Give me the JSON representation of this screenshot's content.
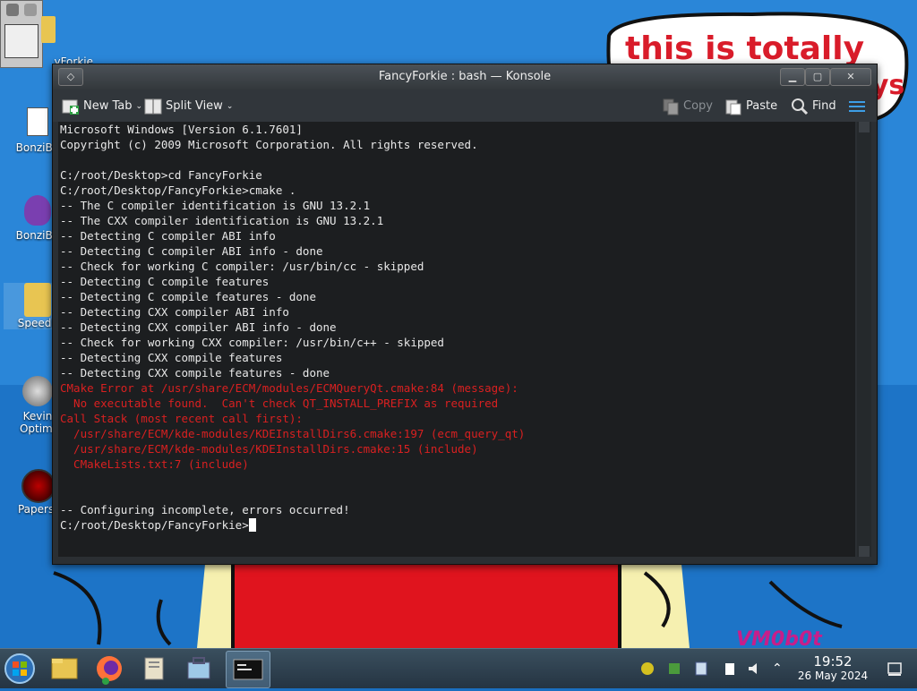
{
  "wallpaper": {
    "text_top": "this is totally",
    "text_top2": "guys",
    "text_bottom": "VM0b0t"
  },
  "desktop_icons": [
    {
      "label": "FancyForkie",
      "display": "yForkie"
    },
    {
      "label": "BonziBuddy",
      "display": "BonziBu"
    },
    {
      "label": "BonziBuddy",
      "display": "BonziBu"
    },
    {
      "label": "SpeedFan",
      "display": "SpeedF"
    },
    {
      "label": "Kevin Optimizer",
      "display": "Kevin"
    },
    {
      "label": "Optimizer",
      "display": "Optimi"
    },
    {
      "label": "Papers, Please",
      "display": "Papers,"
    }
  ],
  "window": {
    "title": "FancyForkie : bash — Konsole",
    "controls": {
      "minimize": "▁",
      "maximize": "▢",
      "close": "✕",
      "menu": "◇"
    }
  },
  "toolbar": {
    "new_tab": "New Tab",
    "split_view": "Split View",
    "copy": "Copy",
    "paste": "Paste",
    "find": "Find"
  },
  "terminal": {
    "lines": [
      {
        "text": "Microsoft Windows [Version 6.1.7601]",
        "type": "normal"
      },
      {
        "text": "Copyright (c) 2009 Microsoft Corporation. All rights reserved.",
        "type": "normal"
      },
      {
        "text": "",
        "type": "normal"
      },
      {
        "text": "C:/root/Desktop>cd FancyForkie",
        "type": "normal"
      },
      {
        "text": "C:/root/Desktop/FancyForkie>cmake .",
        "type": "normal"
      },
      {
        "text": "-- The C compiler identification is GNU 13.2.1",
        "type": "normal"
      },
      {
        "text": "-- The CXX compiler identification is GNU 13.2.1",
        "type": "normal"
      },
      {
        "text": "-- Detecting C compiler ABI info",
        "type": "normal"
      },
      {
        "text": "-- Detecting C compiler ABI info - done",
        "type": "normal"
      },
      {
        "text": "-- Check for working C compiler: /usr/bin/cc - skipped",
        "type": "normal"
      },
      {
        "text": "-- Detecting C compile features",
        "type": "normal"
      },
      {
        "text": "-- Detecting C compile features - done",
        "type": "normal"
      },
      {
        "text": "-- Detecting CXX compiler ABI info",
        "type": "normal"
      },
      {
        "text": "-- Detecting CXX compiler ABI info - done",
        "type": "normal"
      },
      {
        "text": "-- Check for working CXX compiler: /usr/bin/c++ - skipped",
        "type": "normal"
      },
      {
        "text": "-- Detecting CXX compile features",
        "type": "normal"
      },
      {
        "text": "-- Detecting CXX compile features - done",
        "type": "normal"
      },
      {
        "text": "CMake Error at /usr/share/ECM/modules/ECMQueryQt.cmake:84 (message):",
        "type": "error"
      },
      {
        "text": "  No executable found.  Can't check QT_INSTALL_PREFIX as required",
        "type": "error"
      },
      {
        "text": "Call Stack (most recent call first):",
        "type": "error"
      },
      {
        "text": "  /usr/share/ECM/kde-modules/KDEInstallDirs6.cmake:197 (ecm_query_qt)",
        "type": "error"
      },
      {
        "text": "  /usr/share/ECM/kde-modules/KDEInstallDirs.cmake:15 (include)",
        "type": "error"
      },
      {
        "text": "  CMakeLists.txt:7 (include)",
        "type": "error"
      },
      {
        "text": "",
        "type": "normal"
      },
      {
        "text": "",
        "type": "normal"
      },
      {
        "text": "-- Configuring incomplete, errors occurred!",
        "type": "normal"
      }
    ],
    "prompt": "C:/root/Desktop/FancyForkie>"
  },
  "taskbar": {
    "items": [
      "start-orb",
      "file-explorer",
      "firefox",
      "documents",
      "software-center",
      "konsole"
    ],
    "clock_time": "19:52",
    "clock_date": "26 May 2024"
  },
  "colors": {
    "terminal_bg": "#1c1e20",
    "error_text": "#d92020",
    "normal_text": "#e8e8e8"
  }
}
